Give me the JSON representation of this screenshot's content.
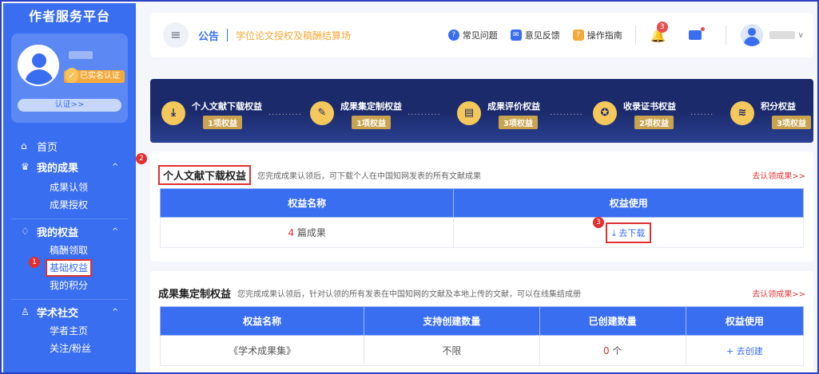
{
  "sidebar": {
    "title": "作者服务平台",
    "verified_label": "已实名认证",
    "cert_button": "认证>>",
    "nav": [
      {
        "icon": "home-icon",
        "glyph": "⌂",
        "label": "首页"
      },
      {
        "icon": "achievement-icon",
        "glyph": "♛",
        "label": "我的成果",
        "chevron": "^",
        "children": [
          "成果认领",
          "成果授权"
        ]
      },
      {
        "icon": "rights-icon",
        "glyph": "♢",
        "label": "我的权益",
        "chevron": "^",
        "children": [
          "稿酬领取",
          "基础权益",
          "我的积分"
        ]
      },
      {
        "icon": "social-icon",
        "glyph": "♙",
        "label": "学术社交",
        "chevron": "^",
        "children": [
          "学者主页",
          "关注/粉丝"
        ]
      }
    ]
  },
  "header": {
    "menu_glyph": "≡",
    "announcement_label": "公告",
    "announcement_text": "学位论文授权及稿酬结算场",
    "links": [
      {
        "icon": "faq-icon",
        "label": "常见问题",
        "color": "#3a6ef0",
        "glyph": "?"
      },
      {
        "icon": "feedback-icon",
        "label": "意见反馈",
        "color": "#3a6ef0",
        "glyph": "✉"
      },
      {
        "icon": "guide-icon",
        "label": "操作指南",
        "color": "#f4a93a",
        "glyph": "?"
      }
    ],
    "notification_count": "3",
    "user_chevron": "∨"
  },
  "rights_banner": [
    {
      "icon": "download-icon",
      "glyph": "⤓",
      "title": "个人文献下载权益",
      "badge": "1项权益"
    },
    {
      "icon": "collection-icon",
      "glyph": "✎",
      "title": "成果集定制权益",
      "badge": "1项权益"
    },
    {
      "icon": "evaluation-icon",
      "glyph": "▤",
      "title": "成果评价权益",
      "badge": "3项权益"
    },
    {
      "icon": "certificate-icon",
      "glyph": "✪",
      "title": "收录证书权益",
      "badge": "2项权益"
    },
    {
      "icon": "points-icon",
      "glyph": "≋",
      "title": "积分权益",
      "badge": "3项权益"
    }
  ],
  "section_download": {
    "title": "个人文献下载权益",
    "desc": "您完成成果认领后，可下载个人在中国知网发表的所有文献成果",
    "link": "去认领成果>>",
    "headers": [
      "权益名称",
      "权益使用"
    ],
    "row": {
      "count": "4",
      "unit": " 篇成果",
      "action": "去下载",
      "action_glyph": "⤓"
    }
  },
  "section_collection": {
    "title": "成果集定制权益",
    "desc": "您完成成果认领后，针对认领的所有发表在中国知网的文献及本地上传的文献，可以在线集结成册",
    "link": "去认领成果>>",
    "headers": [
      "权益名称",
      "支持创建数量",
      "已创建数量",
      "权益使用"
    ],
    "row": {
      "name": "《学术成果集》",
      "support": "不限",
      "created_count": "0",
      "created_unit": " 个",
      "action": "去创建",
      "action_glyph": "+"
    }
  },
  "markers": [
    "1",
    "2",
    "3"
  ],
  "colors": {
    "primary": "#3a6ef0",
    "accent": "#f4a93a",
    "highlight": "#e03030",
    "banner": "#1b2a6b"
  }
}
